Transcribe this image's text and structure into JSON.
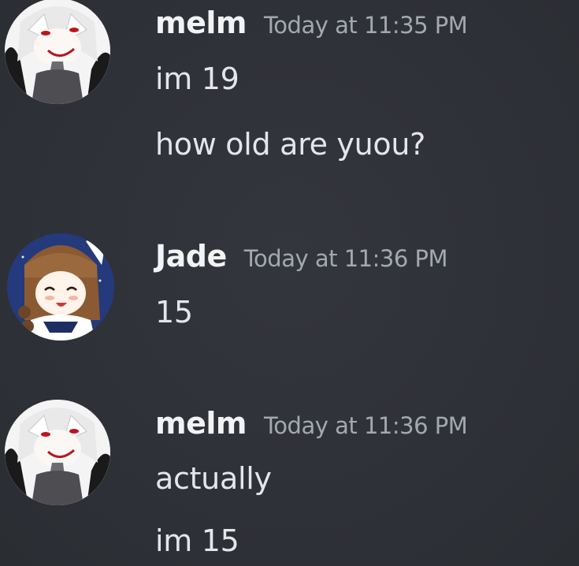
{
  "messages": [
    {
      "author": "melm",
      "timestamp": "Today at 11:35 PM",
      "lines": [
        "im 19",
        "how old are yuou?"
      ]
    },
    {
      "author": "Jade",
      "timestamp": "Today at 11:36 PM",
      "lines": [
        "15"
      ]
    },
    {
      "author": "melm",
      "timestamp": "Today at 11:36 PM",
      "lines": [
        "actually",
        "im 15"
      ]
    }
  ],
  "colors": {
    "background": "#313338",
    "username": "#f2f3f5",
    "timestamp": "#a4a8b0",
    "message_text": "#e4e6ea"
  }
}
